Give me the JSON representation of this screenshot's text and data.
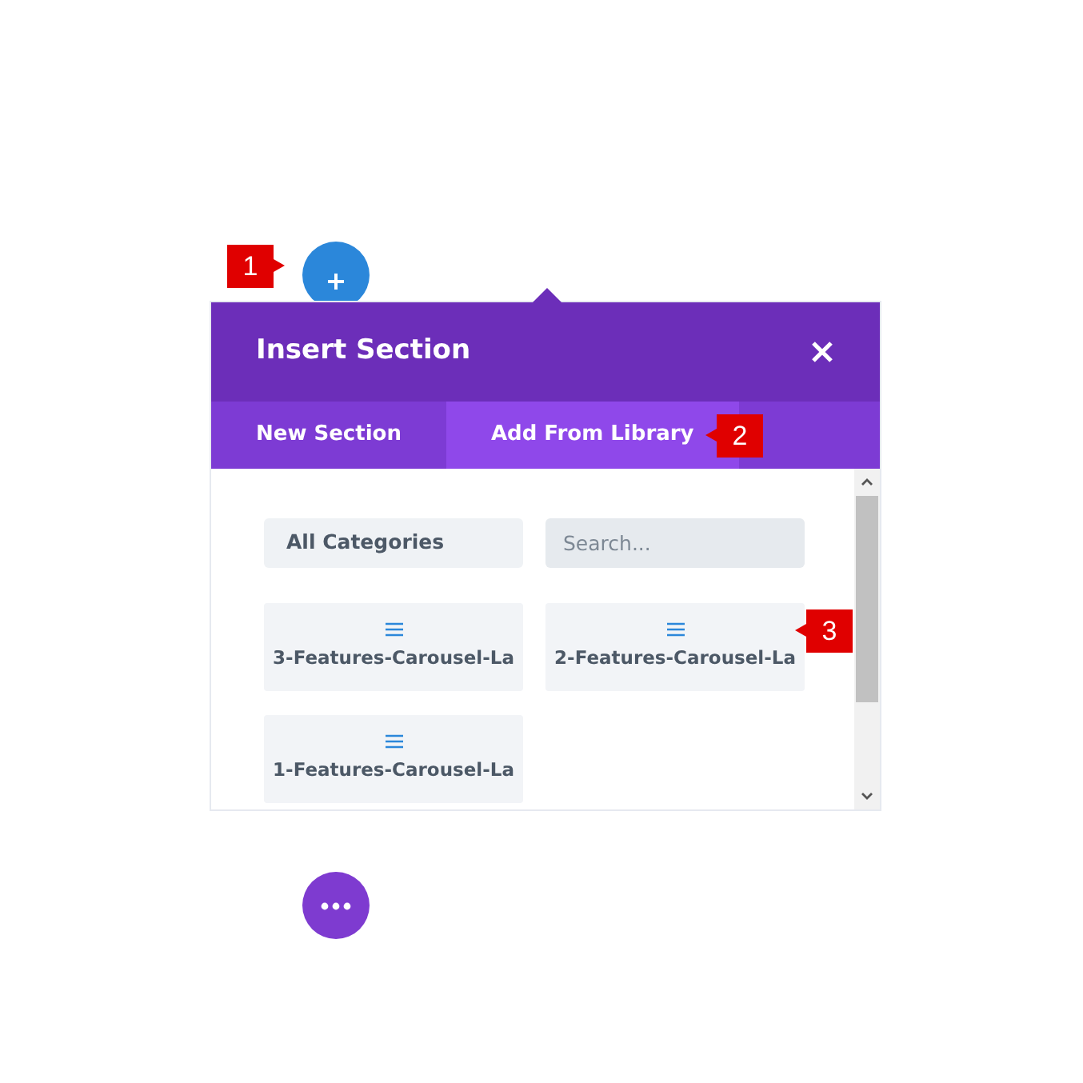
{
  "callouts": [
    {
      "label": "1"
    },
    {
      "label": "2"
    },
    {
      "label": "3"
    }
  ],
  "panel": {
    "title": "Insert Section",
    "tabs": [
      {
        "label": "New Section",
        "selected": false
      },
      {
        "label": "Add From Library",
        "selected": true
      }
    ],
    "category_select": {
      "value": "All Categories"
    },
    "search": {
      "placeholder": "Search..."
    },
    "layouts": [
      {
        "name": "3-Features-Carousel-La"
      },
      {
        "name": "2-Features-Carousel-La"
      },
      {
        "name": "1-Features-Carousel-La"
      }
    ]
  }
}
